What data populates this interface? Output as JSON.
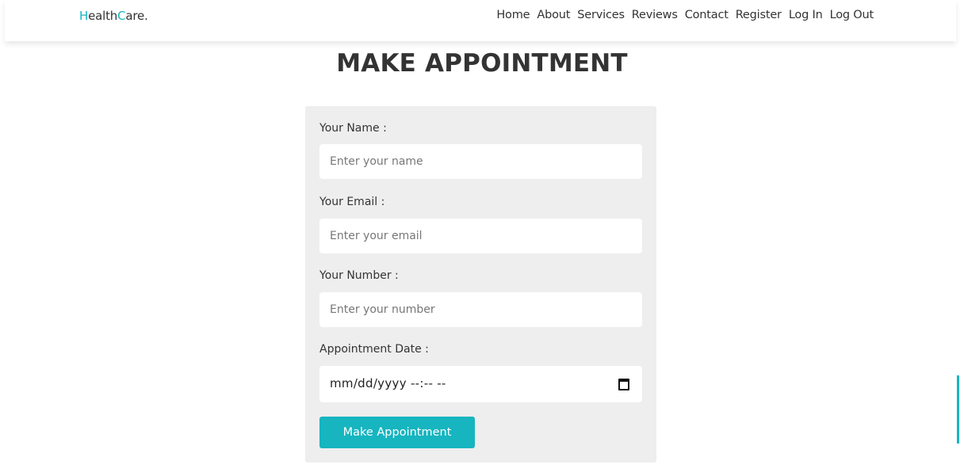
{
  "brand": {
    "logo_first_initial": "H",
    "logo_first_rest": "ealth",
    "logo_second_initial": "C",
    "logo_second_rest": "are.",
    "accent_color": "#16b5bf"
  },
  "nav": {
    "items": [
      "Home",
      "About",
      "Services",
      "Reviews",
      "Contact",
      "Register",
      "Log In",
      "Log Out"
    ]
  },
  "page": {
    "title": "MAKE APPOINTMENT"
  },
  "form": {
    "name_label": "Your Name :",
    "name_placeholder": "Enter your name",
    "email_label": "Your Email :",
    "email_placeholder": "Enter your email",
    "number_label": "Your Number :",
    "number_placeholder": "Enter your number",
    "date_label": "Appointment Date :",
    "date_value": "mm/dd/yyyy --:-- --",
    "submit_label": "Make Appointment"
  },
  "icons": {
    "date_picker": "calendar-icon"
  }
}
